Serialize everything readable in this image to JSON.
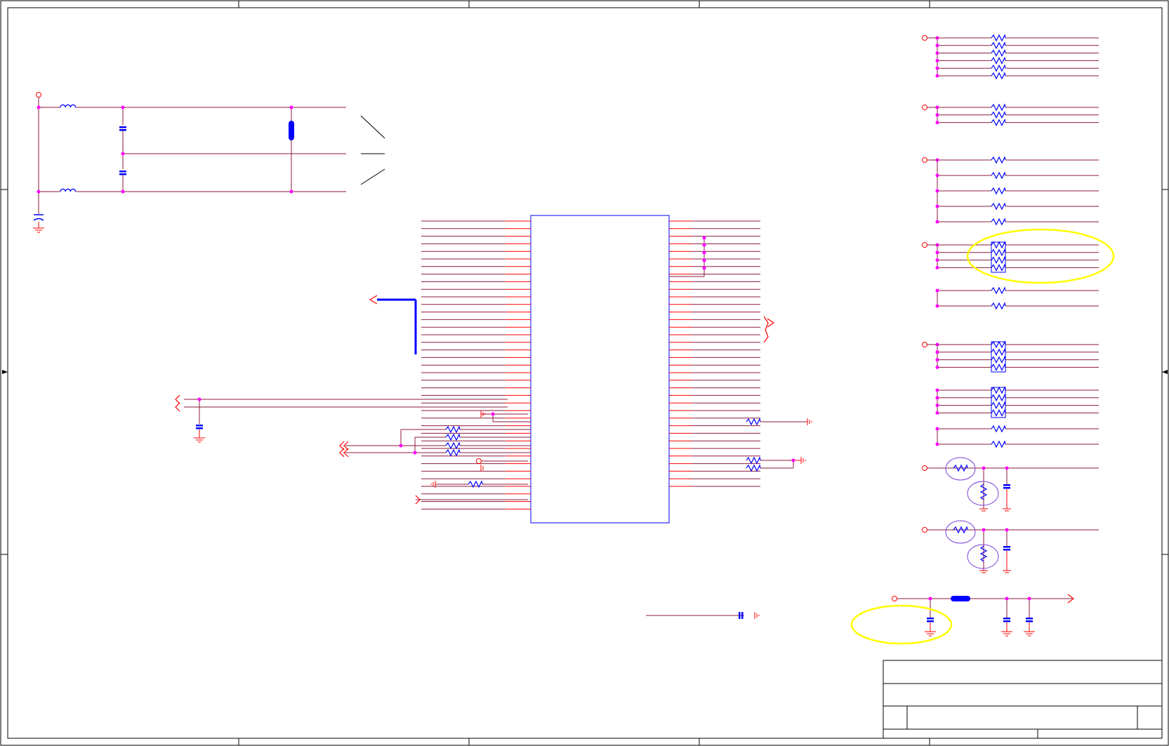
{
  "viewer": {
    "document": "schematic-sheet",
    "colors": {
      "paper": "#ffffff",
      "frame": "#000000",
      "wire": "#8b1a3a",
      "bus": "#0000ff",
      "component": "#0000ff",
      "pin": "#ff0000",
      "junction": "#ff00ff",
      "highlight": "#ffff00",
      "annotation": "#7b3fd6"
    }
  }
}
